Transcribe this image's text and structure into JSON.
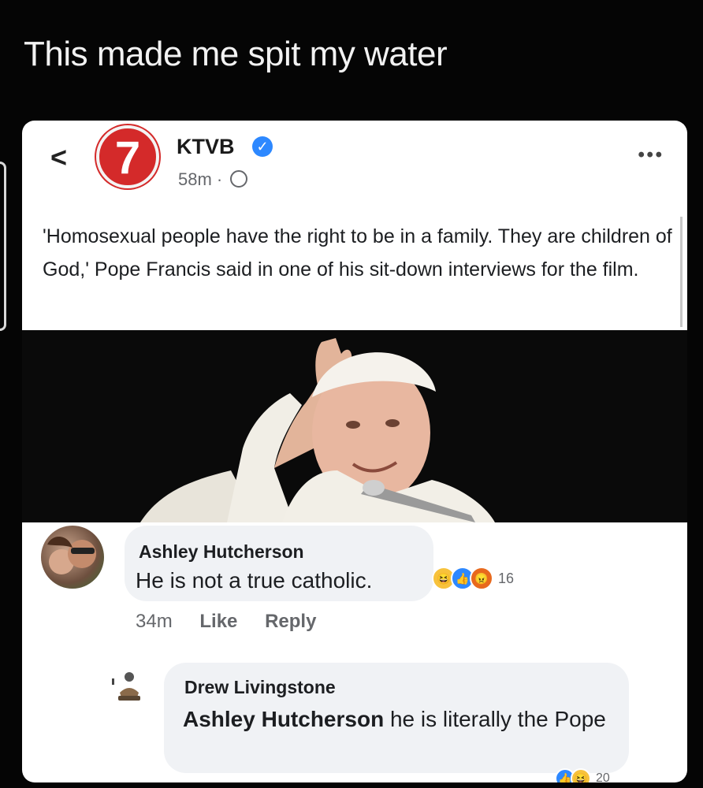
{
  "caption": "This made me spit my water",
  "post": {
    "page_name": "KTVB",
    "logo_text": "7",
    "timestamp": "58m · ",
    "text": "'Homosexual people have the right to be in a family. They are children of God,' Pope Francis said in one of his sit-down interviews for the film."
  },
  "comment": {
    "author": "Ashley Hutcherson",
    "text": "He is not a true catholic.",
    "reaction_count": "16",
    "time": "34m",
    "like_label": "Like",
    "reply_label": "Reply"
  },
  "reply": {
    "author": "Drew Livingstone",
    "mention": "Ashley Hutcherson",
    "text": " he is literally the Pope",
    "reaction_count": "20"
  },
  "colors": {
    "brand_red": "#d42a2a",
    "verified_blue": "#2d88ff",
    "bubble": "#f0f2f5"
  }
}
